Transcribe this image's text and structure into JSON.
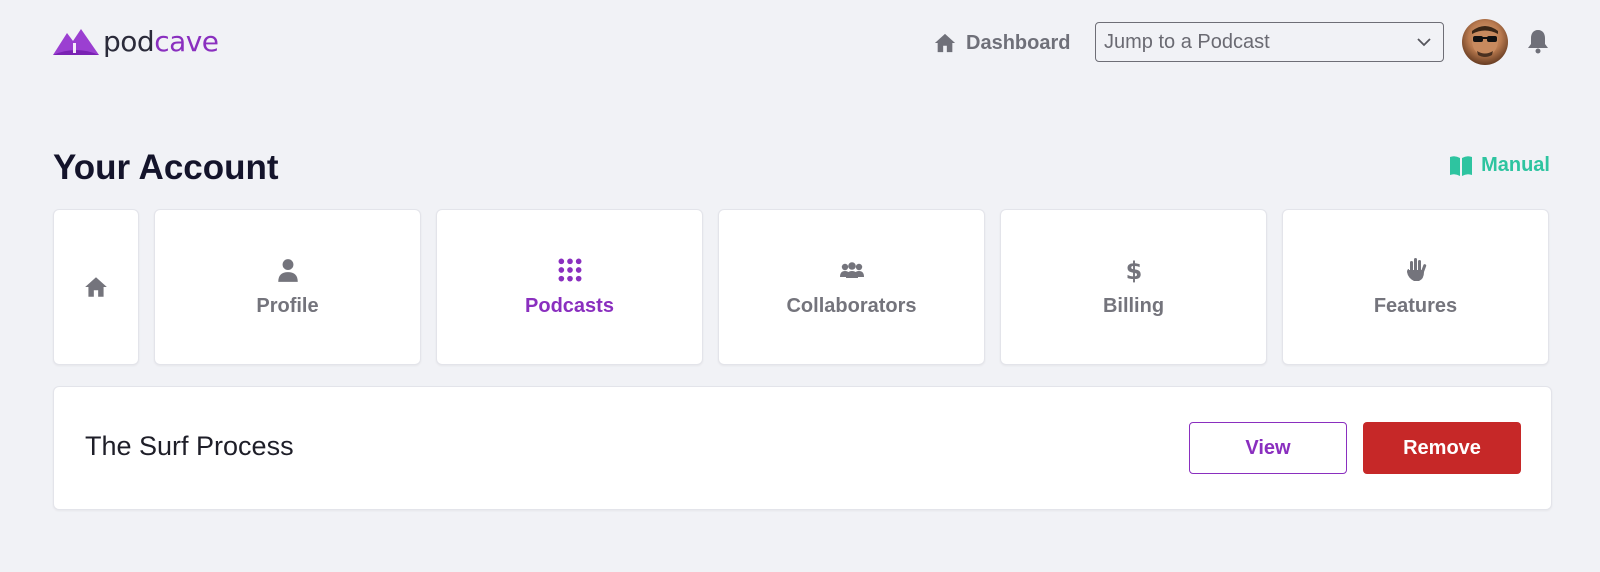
{
  "header": {
    "logo_text_pod": "pod",
    "logo_text_cave": "cave",
    "dashboard_label": "Dashboard",
    "jump_placeholder": "Jump to a Podcast"
  },
  "page": {
    "title": "Your Account",
    "manual_label": "Manual"
  },
  "tabs": [
    {
      "label": "",
      "icon": "home-icon",
      "active": false
    },
    {
      "label": "Profile",
      "icon": "user-icon",
      "active": false
    },
    {
      "label": "Podcasts",
      "icon": "grid-dots-icon",
      "active": true
    },
    {
      "label": "Collaborators",
      "icon": "users-icon",
      "active": false
    },
    {
      "label": "Billing",
      "icon": "dollar-icon",
      "active": false
    },
    {
      "label": "Features",
      "icon": "hand-icon",
      "active": false
    }
  ],
  "podcasts": [
    {
      "name": "The Surf Process",
      "view_label": "View",
      "remove_label": "Remove"
    }
  ],
  "colors": {
    "brand": "#8a2fbf",
    "accent": "#2ec4a0",
    "danger": "#c62828",
    "background": "#f1f2f6"
  }
}
